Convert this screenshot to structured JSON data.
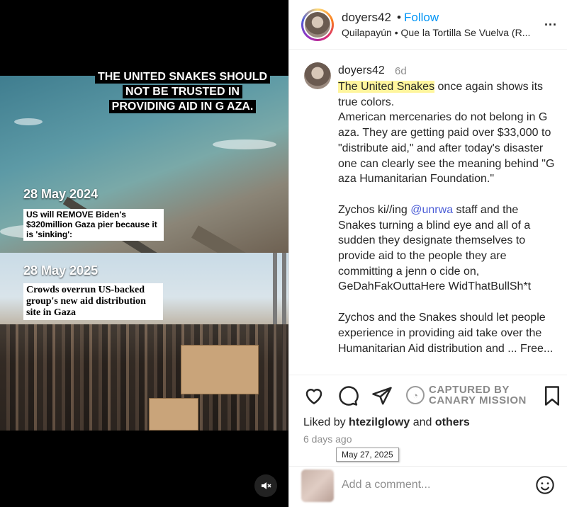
{
  "media": {
    "headline": "THE UNITED SNAKES SHOULD NOT BE TRUSTED IN PROVIDING AID IN G AZA.",
    "panel1": {
      "date": "28 May 2024",
      "caption": "US will REMOVE Biden's $320million Gaza pier because it is 'sinking':"
    },
    "panel2": {
      "date": "28 May 2025",
      "caption": "Crowds overrun US-backed group's new aid distribution site in Gaza"
    },
    "mute_icon": "speaker-muted-icon"
  },
  "post_header": {
    "username": "doyers42",
    "separator": "•",
    "follow_label": "Follow",
    "audio": "Quilapayún • Que la Tortilla Se Vuelva (R...",
    "more_label": "..."
  },
  "comment": {
    "username": "doyers42",
    "age": "6d",
    "highlight": "The United Snakes",
    "line1_rest": " once again shows its true colors.",
    "para2": "American mercenaries do not belong in G aza. They are getting paid over $33,000 to \"distribute aid,\" and after today's disaster one can clearly see the meaning behind \"G aza Humanitarian Foundation.\"",
    "para3_start": "Zychos ki//ing ",
    "mention": "@unrwa",
    "para3_rest": " staff and the Snakes turning a blind eye and all of a sudden they designate themselves to provide aid to the people they are committing a jenn o cide on, GeDahFakOuttaHere WidThatBullSh*t",
    "para4": "Zychos and the Snakes should let people experience in providing aid take over the Humanitarian Aid distribution and ... Free..."
  },
  "actions": {
    "icons": [
      "heart-icon",
      "comment-icon",
      "share-icon",
      "bookmark-icon"
    ],
    "watermark_line1": "CAPTURED BY",
    "watermark_line2": "CANARY MISSION"
  },
  "likes": {
    "prefix": "Liked by ",
    "user": "htezilglowy",
    "middle": " and ",
    "others": "others"
  },
  "time": {
    "ago": "6 days ago",
    "tooltip": "May 27, 2025"
  },
  "add_comment": {
    "placeholder": "Add a comment...",
    "emoji_icon": "emoji-smile-icon"
  },
  "colors": {
    "link": "#0095f6",
    "mention": "#4a5cd6",
    "highlight": "#fff59d"
  }
}
